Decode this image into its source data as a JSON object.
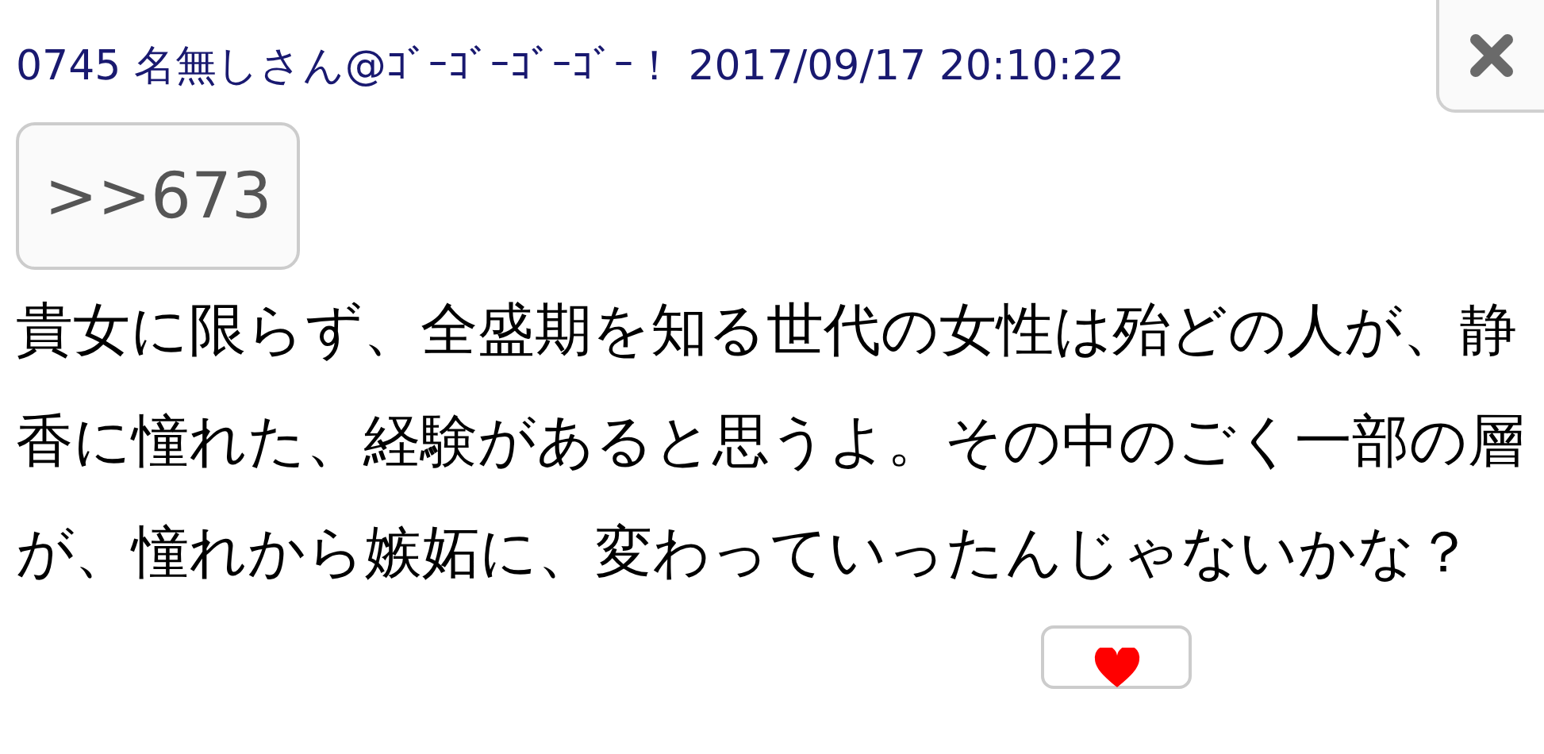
{
  "post": {
    "header": "0745 名無しさん@ｺﾞｰｺﾞｰｺﾞｰｺﾞｰ！ 2017/09/17 20:10:22",
    "anchor": ">>673",
    "body": "貴女に限らず、全盛期を知る世代の女性は殆どの人が、静香に憧れた、経験があると思うよ。その中のごく一部の層が、憧れから嫉妬に、変わっていったんじゃないかな？"
  }
}
